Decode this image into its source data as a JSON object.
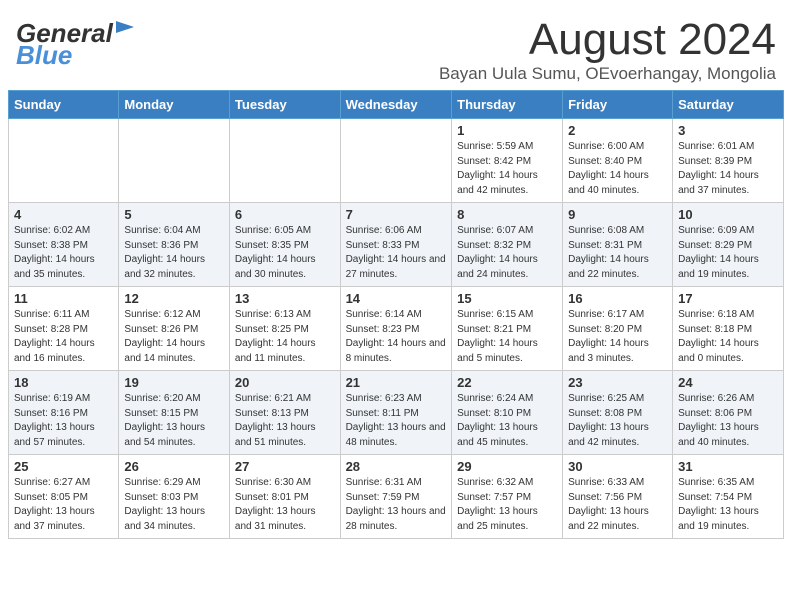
{
  "header": {
    "title": "August 2024",
    "subtitle": "Bayan Uula Sumu, OEvoerhangay, Mongolia",
    "logo_general": "General",
    "logo_blue": "Blue"
  },
  "calendar": {
    "days_of_week": [
      "Sunday",
      "Monday",
      "Tuesday",
      "Wednesday",
      "Thursday",
      "Friday",
      "Saturday"
    ],
    "weeks": [
      [
        {
          "day": "",
          "content": ""
        },
        {
          "day": "",
          "content": ""
        },
        {
          "day": "",
          "content": ""
        },
        {
          "day": "",
          "content": ""
        },
        {
          "day": "1",
          "content": "Sunrise: 5:59 AM\nSunset: 8:42 PM\nDaylight: 14 hours\nand 42 minutes."
        },
        {
          "day": "2",
          "content": "Sunrise: 6:00 AM\nSunset: 8:40 PM\nDaylight: 14 hours\nand 40 minutes."
        },
        {
          "day": "3",
          "content": "Sunrise: 6:01 AM\nSunset: 8:39 PM\nDaylight: 14 hours\nand 37 minutes."
        }
      ],
      [
        {
          "day": "4",
          "content": "Sunrise: 6:02 AM\nSunset: 8:38 PM\nDaylight: 14 hours\nand 35 minutes."
        },
        {
          "day": "5",
          "content": "Sunrise: 6:04 AM\nSunset: 8:36 PM\nDaylight: 14 hours\nand 32 minutes."
        },
        {
          "day": "6",
          "content": "Sunrise: 6:05 AM\nSunset: 8:35 PM\nDaylight: 14 hours\nand 30 minutes."
        },
        {
          "day": "7",
          "content": "Sunrise: 6:06 AM\nSunset: 8:33 PM\nDaylight: 14 hours\nand 27 minutes."
        },
        {
          "day": "8",
          "content": "Sunrise: 6:07 AM\nSunset: 8:32 PM\nDaylight: 14 hours\nand 24 minutes."
        },
        {
          "day": "9",
          "content": "Sunrise: 6:08 AM\nSunset: 8:31 PM\nDaylight: 14 hours\nand 22 minutes."
        },
        {
          "day": "10",
          "content": "Sunrise: 6:09 AM\nSunset: 8:29 PM\nDaylight: 14 hours\nand 19 minutes."
        }
      ],
      [
        {
          "day": "11",
          "content": "Sunrise: 6:11 AM\nSunset: 8:28 PM\nDaylight: 14 hours\nand 16 minutes."
        },
        {
          "day": "12",
          "content": "Sunrise: 6:12 AM\nSunset: 8:26 PM\nDaylight: 14 hours\nand 14 minutes."
        },
        {
          "day": "13",
          "content": "Sunrise: 6:13 AM\nSunset: 8:25 PM\nDaylight: 14 hours\nand 11 minutes."
        },
        {
          "day": "14",
          "content": "Sunrise: 6:14 AM\nSunset: 8:23 PM\nDaylight: 14 hours\nand 8 minutes."
        },
        {
          "day": "15",
          "content": "Sunrise: 6:15 AM\nSunset: 8:21 PM\nDaylight: 14 hours\nand 5 minutes."
        },
        {
          "day": "16",
          "content": "Sunrise: 6:17 AM\nSunset: 8:20 PM\nDaylight: 14 hours\nand 3 minutes."
        },
        {
          "day": "17",
          "content": "Sunrise: 6:18 AM\nSunset: 8:18 PM\nDaylight: 14 hours\nand 0 minutes."
        }
      ],
      [
        {
          "day": "18",
          "content": "Sunrise: 6:19 AM\nSunset: 8:16 PM\nDaylight: 13 hours\nand 57 minutes."
        },
        {
          "day": "19",
          "content": "Sunrise: 6:20 AM\nSunset: 8:15 PM\nDaylight: 13 hours\nand 54 minutes."
        },
        {
          "day": "20",
          "content": "Sunrise: 6:21 AM\nSunset: 8:13 PM\nDaylight: 13 hours\nand 51 minutes."
        },
        {
          "day": "21",
          "content": "Sunrise: 6:23 AM\nSunset: 8:11 PM\nDaylight: 13 hours\nand 48 minutes."
        },
        {
          "day": "22",
          "content": "Sunrise: 6:24 AM\nSunset: 8:10 PM\nDaylight: 13 hours\nand 45 minutes."
        },
        {
          "day": "23",
          "content": "Sunrise: 6:25 AM\nSunset: 8:08 PM\nDaylight: 13 hours\nand 42 minutes."
        },
        {
          "day": "24",
          "content": "Sunrise: 6:26 AM\nSunset: 8:06 PM\nDaylight: 13 hours\nand 40 minutes."
        }
      ],
      [
        {
          "day": "25",
          "content": "Sunrise: 6:27 AM\nSunset: 8:05 PM\nDaylight: 13 hours\nand 37 minutes."
        },
        {
          "day": "26",
          "content": "Sunrise: 6:29 AM\nSunset: 8:03 PM\nDaylight: 13 hours\nand 34 minutes."
        },
        {
          "day": "27",
          "content": "Sunrise: 6:30 AM\nSunset: 8:01 PM\nDaylight: 13 hours\nand 31 minutes."
        },
        {
          "day": "28",
          "content": "Sunrise: 6:31 AM\nSunset: 7:59 PM\nDaylight: 13 hours\nand 28 minutes."
        },
        {
          "day": "29",
          "content": "Sunrise: 6:32 AM\nSunset: 7:57 PM\nDaylight: 13 hours\nand 25 minutes."
        },
        {
          "day": "30",
          "content": "Sunrise: 6:33 AM\nSunset: 7:56 PM\nDaylight: 13 hours\nand 22 minutes."
        },
        {
          "day": "31",
          "content": "Sunrise: 6:35 AM\nSunset: 7:54 PM\nDaylight: 13 hours\nand 19 minutes."
        }
      ]
    ]
  }
}
